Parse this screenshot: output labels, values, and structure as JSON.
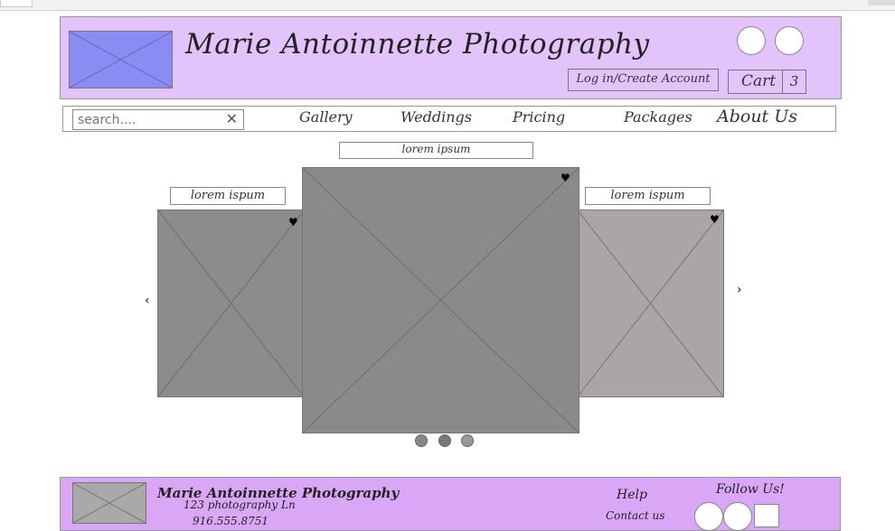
{
  "header": {
    "site_title": "Marie Antoinnette Photography",
    "login_label": "Log in/Create Account",
    "cart_label": "Cart",
    "cart_count": "3"
  },
  "nav": {
    "search_placeholder": "search....",
    "links": [
      "Gallery",
      "Weddings",
      "Pricing",
      "Packages",
      "About Us"
    ]
  },
  "carousel": {
    "main_caption": "lorem ipsum",
    "left_caption": "lorem ispum",
    "right_caption": "lorem ispum",
    "prev_label": "‹",
    "next_label": "›",
    "dots": 3
  },
  "footer": {
    "title": "Marie Antoinnette Photography",
    "address": "123 photography Ln",
    "phone": "916.555.8751",
    "help": "Help",
    "contact": "Contact us",
    "follow": "Follow Us!"
  },
  "colors": {
    "header_bg": "#e3c3fb",
    "footer_bg": "#d9a7f6",
    "logo_placeholder": "#8b8bf4",
    "image_placeholder": "#8c8c8c",
    "image_placeholder_light": "#aba6a6"
  }
}
